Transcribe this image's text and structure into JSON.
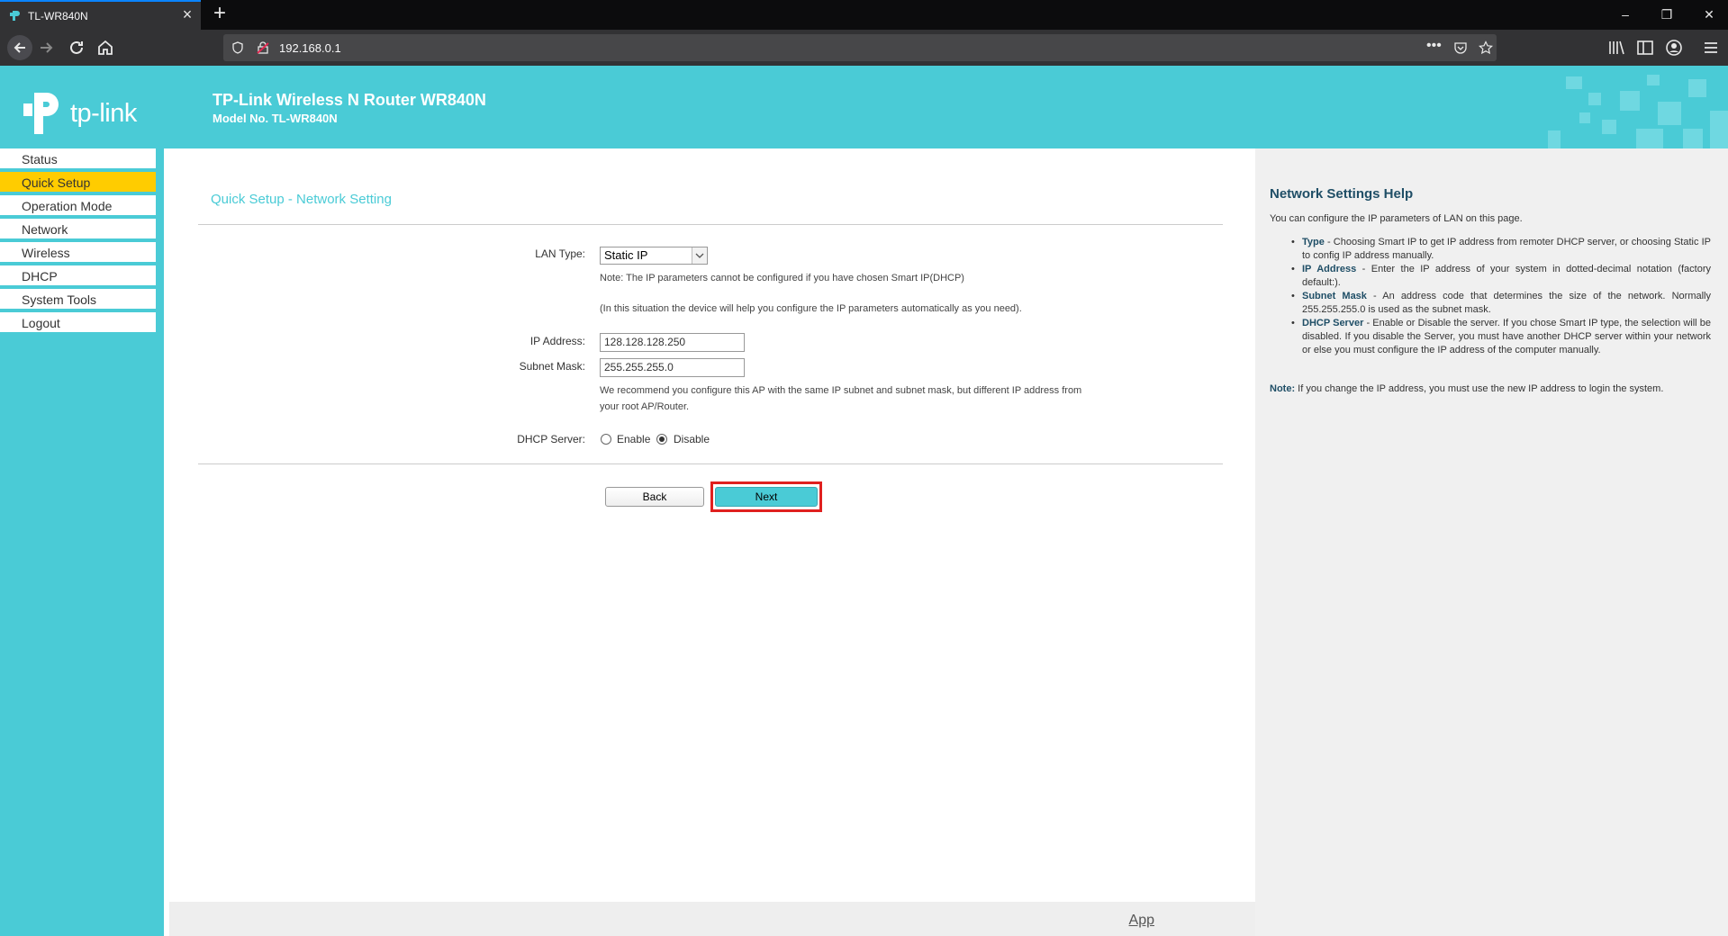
{
  "browser": {
    "tab_title": "TL-WR840N",
    "url": "192.168.0.1"
  },
  "router": {
    "logo_text": "tp-link",
    "product_title": "TP-Link Wireless N Router WR840N",
    "model_no": "Model No. TL-WR840N"
  },
  "sidebar": {
    "items": [
      {
        "label": "Status"
      },
      {
        "label": "Quick Setup",
        "active": true
      },
      {
        "label": "Operation Mode"
      },
      {
        "label": "Network"
      },
      {
        "label": "Wireless"
      },
      {
        "label": "DHCP"
      },
      {
        "label": "System Tools"
      },
      {
        "label": "Logout"
      }
    ]
  },
  "main": {
    "title": "Quick Setup - Network Setting",
    "lan_type_label": "LAN Type:",
    "lan_type_value": "Static IP",
    "note1": "Note: The IP parameters cannot be configured if you have chosen Smart IP(DHCP)",
    "note2": "(In this situation the device will help you configure the IP parameters automatically as you need).",
    "ip_label": "IP Address:",
    "ip_value": "128.128.128.250",
    "mask_label": "Subnet Mask:",
    "mask_value": "255.255.255.0",
    "recommend1": "We recommend you configure this AP with the same IP subnet and subnet mask, but different IP address from",
    "recommend2": "your root AP/Router.",
    "dhcp_label": "DHCP Server:",
    "dhcp_enable": "Enable",
    "dhcp_disable": "Disable",
    "dhcp_selected": "Disable",
    "back_label": "Back",
    "next_label": "Next",
    "footer_link": "App"
  },
  "help": {
    "title": "Network Settings Help",
    "intro": "You can configure the IP parameters of LAN on this page.",
    "items": [
      {
        "term": "Type",
        "text": " - Choosing Smart IP to get IP address from remoter DHCP server, or choosing Static IP to config IP address manually."
      },
      {
        "term": "IP Address",
        "text": " - Enter the IP address of your system in dotted-decimal notation (factory default:)."
      },
      {
        "term": "Subnet Mask",
        "text": " - An address code that determines the size of the network. Normally 255.255.255.0 is used as the subnet mask."
      },
      {
        "term": "DHCP Server",
        "text": " - Enable or Disable the server. If you chose Smart IP type, the selection will be disabled. If you disable the Server, you must have another DHCP server within your network or else you must configure the IP address of the computer manually."
      }
    ],
    "note_label": "Note:",
    "note_text": " If you change the IP address, you must use the new IP address to login the system."
  },
  "colors": {
    "brand_teal": "#4acbd6",
    "active_menu": "#ffcc00",
    "highlight_border": "#e0201f"
  }
}
